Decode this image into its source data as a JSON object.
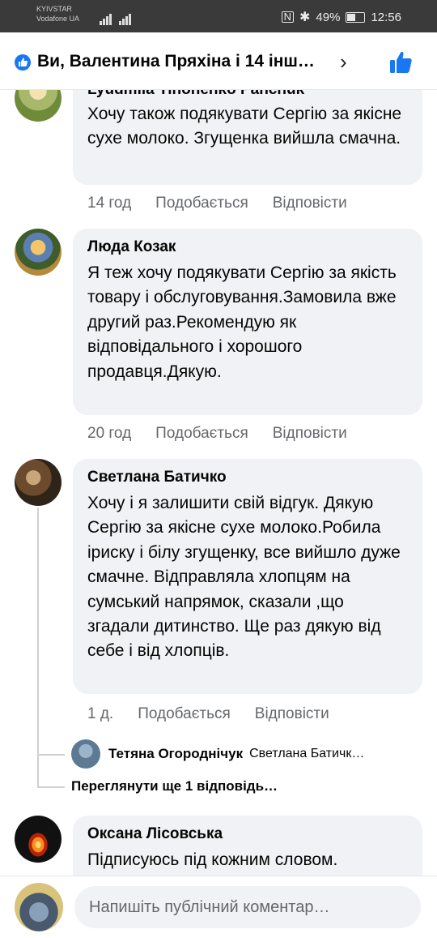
{
  "status_bar": {
    "carrier_1": "KYIVSTAR",
    "carrier_2": "Vodafone UA",
    "battery": "49%",
    "time": "12:56"
  },
  "header": {
    "title": "Ви, Валентина Пряхіна і 14 інш…",
    "accent": "#1877f2"
  },
  "comments": [
    {
      "author": "Lyudmila Tinonenko Pancnuk",
      "text": "Хочу також подякувати Сергію за якісне сухе молоко. Згущенка вийшла смачна.",
      "time": "14 год",
      "like": "Подобається",
      "reply": "Відповісти"
    },
    {
      "author": "Люда Козак",
      "text": "Я теж хочу подякувати Сергію за якість товару і обслуговування.Замовила вже другий раз.Рекомендую як відповідального і хорошого продавця.Дякую.",
      "time": "20 год",
      "like": "Подобається",
      "reply": "Відповісти"
    },
    {
      "author": "Светлана Батичко",
      "text": "Хочу і я залишити свій відгук. Дякую Сергію за якісне сухе молоко.Робила іриску і білу згущенку, все вийшло дуже смачне. Відправляла хлопцям на сумський напрямок, сказали ,що згадали дитинство. Ще раз дякую від себе і від хлопців.",
      "time": "1 д.",
      "like": "Подобається",
      "reply": "Відповісти",
      "reply_preview": {
        "author": "Тетяна Огороднічук",
        "text": "Светлана Батичк…"
      },
      "more_replies": "Переглянути ще 1 відповідь…"
    },
    {
      "author": "Оксана Лісовська",
      "text": "Підписуюсь під кожним словом."
    }
  ],
  "composer": {
    "placeholder": "Напишіть публічний коментар…"
  }
}
